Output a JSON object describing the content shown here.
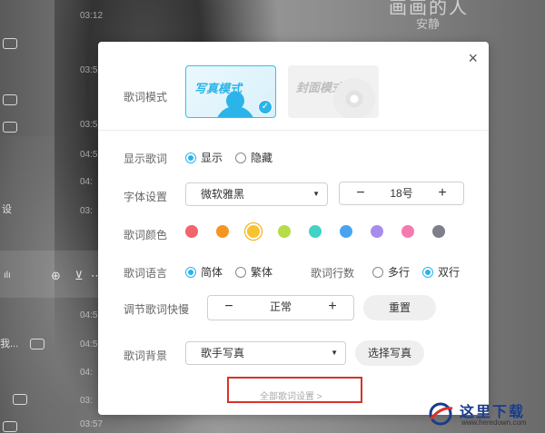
{
  "background": {
    "song_title": "画画的人",
    "song_subtitle": "安静",
    "times": [
      "03:12",
      "03:5",
      "03:5",
      "04:5",
      "04:",
      "03:",
      "04:5",
      "04:5",
      "04:",
      "03:",
      "04:5",
      "03:57"
    ],
    "side_text": [
      "设",
      "我..."
    ]
  },
  "dialog": {
    "close_glyph": "×",
    "lyric_mode": {
      "label": "歌词模式",
      "options": [
        {
          "title": "写真模式",
          "selected": true
        },
        {
          "title": "封面模式",
          "selected": false
        }
      ]
    },
    "show_lyrics": {
      "label": "显示歌词",
      "options": [
        {
          "label": "显示",
          "checked": true
        },
        {
          "label": "隐藏",
          "checked": false
        }
      ]
    },
    "font": {
      "label": "字体设置",
      "family": "微软雅黑",
      "size": "18号",
      "minus": "−",
      "plus": "+"
    },
    "colors": {
      "label": "歌词颜色",
      "swatches": [
        "#f1646e",
        "#f5961e",
        "#f8c331",
        "#b6dc47",
        "#44d1c6",
        "#4aa3f0",
        "#a98bef",
        "#f47bb1",
        "#7f7f8b"
      ],
      "selected_index": 2
    },
    "language": {
      "label": "歌词语言",
      "options": [
        {
          "label": "简体",
          "checked": true
        },
        {
          "label": "繁体",
          "checked": false
        }
      ]
    },
    "rows": {
      "label": "歌词行数",
      "options": [
        {
          "label": "多行",
          "checked": false
        },
        {
          "label": "双行",
          "checked": true
        }
      ]
    },
    "speed": {
      "label": "调节歌词快慢",
      "value": "正常",
      "minus": "−",
      "plus": "+",
      "reset": "重置"
    },
    "background_setting": {
      "label": "歌词背景",
      "value": "歌手写真",
      "choose": "选择写真"
    },
    "footer_link": "全部歌词设置 >"
  },
  "watermark": {
    "text": "这里下载",
    "url": "www.heredown.com",
    "colors": {
      "blue": "#1a3c8a",
      "red": "#d9322a"
    }
  }
}
